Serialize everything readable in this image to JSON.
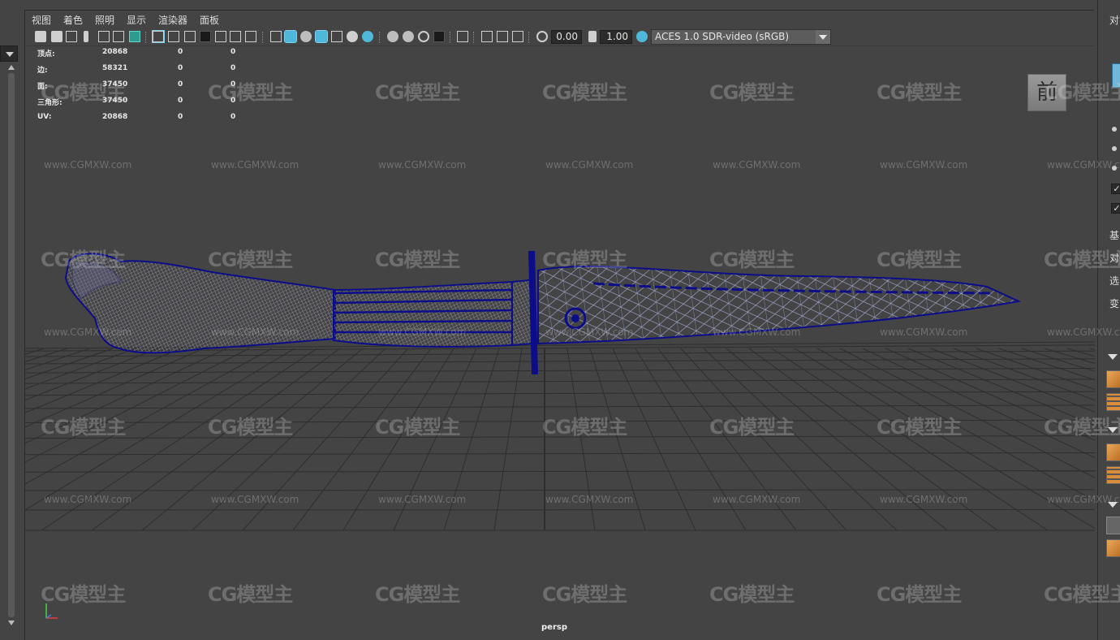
{
  "menubar": {
    "items": [
      "视图",
      "着色",
      "照明",
      "显示",
      "渲染器",
      "面板"
    ]
  },
  "toolbar": {
    "exposure_value": "0.00",
    "gamma_value": "1.00",
    "color_space": "ACES 1.0 SDR-video (sRGB)",
    "icons": [
      "camera-icon",
      "camera-attr-icon",
      "bookmark-icon",
      "image-plane-icon",
      "grid-toggle-icon",
      "film-gate-icon",
      "resolution-gate-icon",
      "wireframe-icon",
      "smooth-shade-icon",
      "textured-icon",
      "lighting-icon",
      "shadows-icon",
      "isolate-select-icon",
      "xray-icon",
      "exposure-icon",
      "gamma-icon",
      "color-management-icon"
    ]
  },
  "hud": {
    "rows": [
      {
        "label": "顶点:",
        "v1": "20868",
        "v2": "0",
        "v3": "0"
      },
      {
        "label": "边:",
        "v1": "58321",
        "v2": "0",
        "v3": "0"
      },
      {
        "label": "面:",
        "v1": "37450",
        "v2": "0",
        "v3": "0"
      },
      {
        "label": "三角形:",
        "v1": "37450",
        "v2": "0",
        "v3": "0"
      },
      {
        "label": "UV:",
        "v1": "20868",
        "v2": "0",
        "v3": "0"
      }
    ]
  },
  "view_cube": {
    "label": "前"
  },
  "viewport": {
    "camera_label": "persp",
    "wire_color": "#0d0d8a",
    "grid_color": "#2e2e2e"
  },
  "watermark": {
    "logo": "CG模型主",
    "url": "www.CGMXW.com"
  },
  "right_panel": {
    "title": "对象",
    "labels": [
      "基",
      "对",
      "选",
      "变"
    ],
    "accent": "#6fb8dc"
  }
}
